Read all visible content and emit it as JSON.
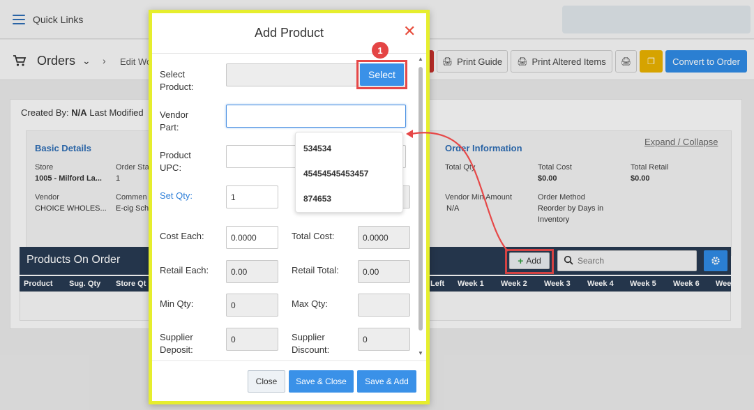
{
  "topbar": {
    "quick_links": "Quick Links"
  },
  "subbar": {
    "title": "Orders",
    "breadcrumb_item": "Edit Wo",
    "print_guide": "Print Guide",
    "print_altered": "Print Altered Items",
    "convert": "Convert to Order"
  },
  "created_by": {
    "prefix": "Created By: ",
    "value": "N/A",
    "suffix": " Last Modified"
  },
  "details": {
    "expand": "Expand / Collapse",
    "basic_title": "Basic Details",
    "order_info_title": "Order Information",
    "store_label": "Store",
    "store_value": "1005 - Milford La...",
    "order_status_label": "Order Sta",
    "order_status_value": "1",
    "vendor_label": "Vendor",
    "vendor_value": "CHOICE WHOLES...",
    "comment_label": "Commen",
    "comment_value": "E-cig Sch",
    "total_qty_label": "Total Qty",
    "total_cost_label": "Total Cost",
    "total_cost_value": "$0.00",
    "total_retail_label": "Total Retail",
    "total_retail_value": "$0.00",
    "vendor_min_label": "Vendor Min Amount",
    "vendor_min_value": "N/A",
    "order_method_label": "Order Method",
    "order_method_value_1": "Reorder by Days in",
    "order_method_value_2": "Inventory"
  },
  "products": {
    "title": "Products On Order",
    "add": "Add",
    "search_placeholder": "Search",
    "columns": [
      "Product",
      "Sug. Qty",
      "Store Qt",
      "Left",
      "Week 1",
      "Week 2",
      "Week 3",
      "Week 4",
      "Week 5",
      "Week 6",
      "Wee"
    ]
  },
  "modal": {
    "title": "Add Product",
    "select_product_1": "Select",
    "select_product_2": "Product:",
    "select_btn": "Select",
    "vendor_part_1": "Vendor",
    "vendor_part_2": "Part:",
    "product_upc_1": "Product",
    "product_upc_2": "UPC:",
    "set_qty": "Set Qty:",
    "set_qty_value": "1",
    "cost_each": "Cost Each:",
    "cost_each_value": "0.0000",
    "total_cost": "Total Cost:",
    "total_cost_value": "0.0000",
    "retail_each": "Retail Each:",
    "retail_each_value": "0.00",
    "retail_total": "Retail Total:",
    "retail_total_value": "0.00",
    "min_qty": "Min Qty:",
    "min_qty_value": "0",
    "max_qty": "Max Qty:",
    "supplier_deposit_1": "Supplier",
    "supplier_deposit_2": "Deposit:",
    "supplier_deposit_value": "0",
    "supplier_discount_1": "Supplier",
    "supplier_discount_2": "Discount:",
    "supplier_discount_value": "0",
    "close_btn": "Close",
    "save_close_btn": "Save & Close",
    "save_add_btn": "Save & Add"
  },
  "dropdown": {
    "items": [
      "534534",
      "45454545453457",
      "874653"
    ]
  },
  "annotation": {
    "step": "1",
    "color": "#e64848"
  },
  "colors": {
    "accent": "#3a91e8",
    "navy": "#283a52",
    "modal_border": "#e6ee2e"
  }
}
